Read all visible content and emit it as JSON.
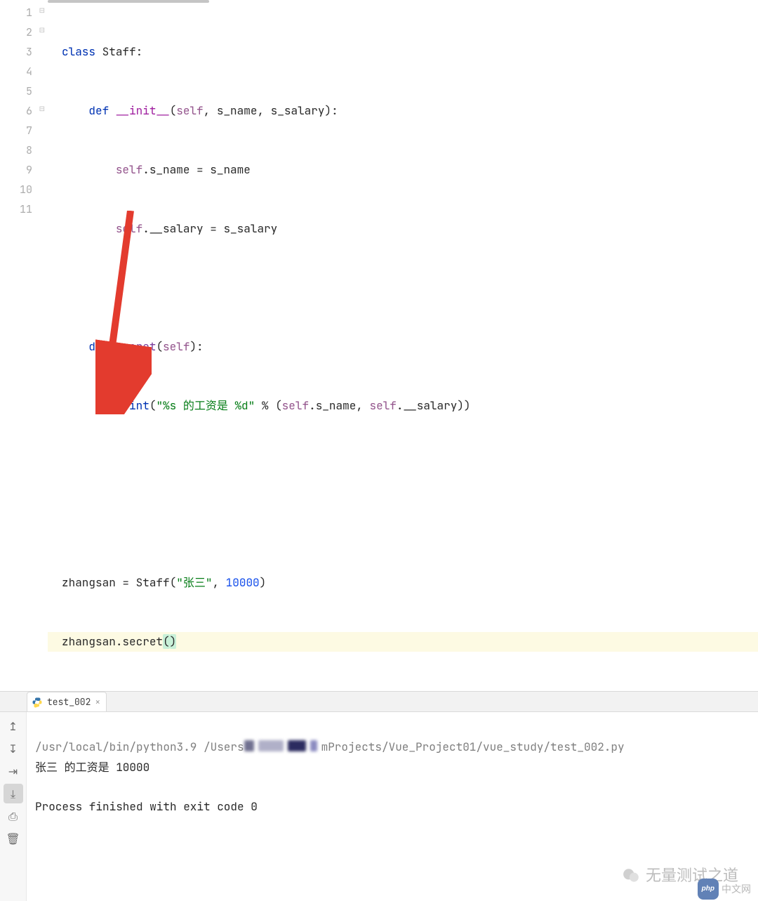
{
  "editor": {
    "current_line": 11,
    "lines": [
      1,
      2,
      3,
      4,
      5,
      6,
      7,
      8,
      9,
      10,
      11
    ],
    "tokens": {
      "l1": {
        "class": "class",
        "Staff": "Staff"
      },
      "l2": {
        "def": "def",
        "init": "__init__",
        "self": "self",
        "p1": "s_name",
        "p2": "s_salary"
      },
      "l3": {
        "self": "self",
        "attr": "s_name",
        "rhs": "s_name"
      },
      "l4": {
        "self": "self",
        "attr": "__salary",
        "rhs": "s_salary"
      },
      "l6": {
        "def": "def",
        "name": "secret",
        "self": "self"
      },
      "l7": {
        "print": "print",
        "s1": "\"%s 的工资是 %d\"",
        "pct": "%",
        "self1": "self",
        "a1": "s_name",
        "self2": "self",
        "a2": "__salary"
      },
      "l10": {
        "var": "zhangsan",
        "cls": "Staff",
        "s": "\"张三\"",
        "n": "10000"
      },
      "l11": {
        "var": "zhangsan",
        "m": "secret"
      }
    }
  },
  "run_tab": {
    "label": "test_002",
    "close_glyph": "×"
  },
  "console": {
    "cmd_prefix": "/usr/local/bin/python3.9 /Users",
    "cmd_suffix": "mProjects/Vue_Project01/vue_study/test_002.py",
    "output_line": "张三 的工资是 10000",
    "exit_line": "Process finished with exit code 0"
  },
  "tool_icons": {
    "up": "↥",
    "down": "↧",
    "wrap": "⇥",
    "scroll": "⤓",
    "print": "⎙",
    "trash": "🗑"
  },
  "watermark": {
    "text": "无量测试之道",
    "sub": "中文网"
  }
}
